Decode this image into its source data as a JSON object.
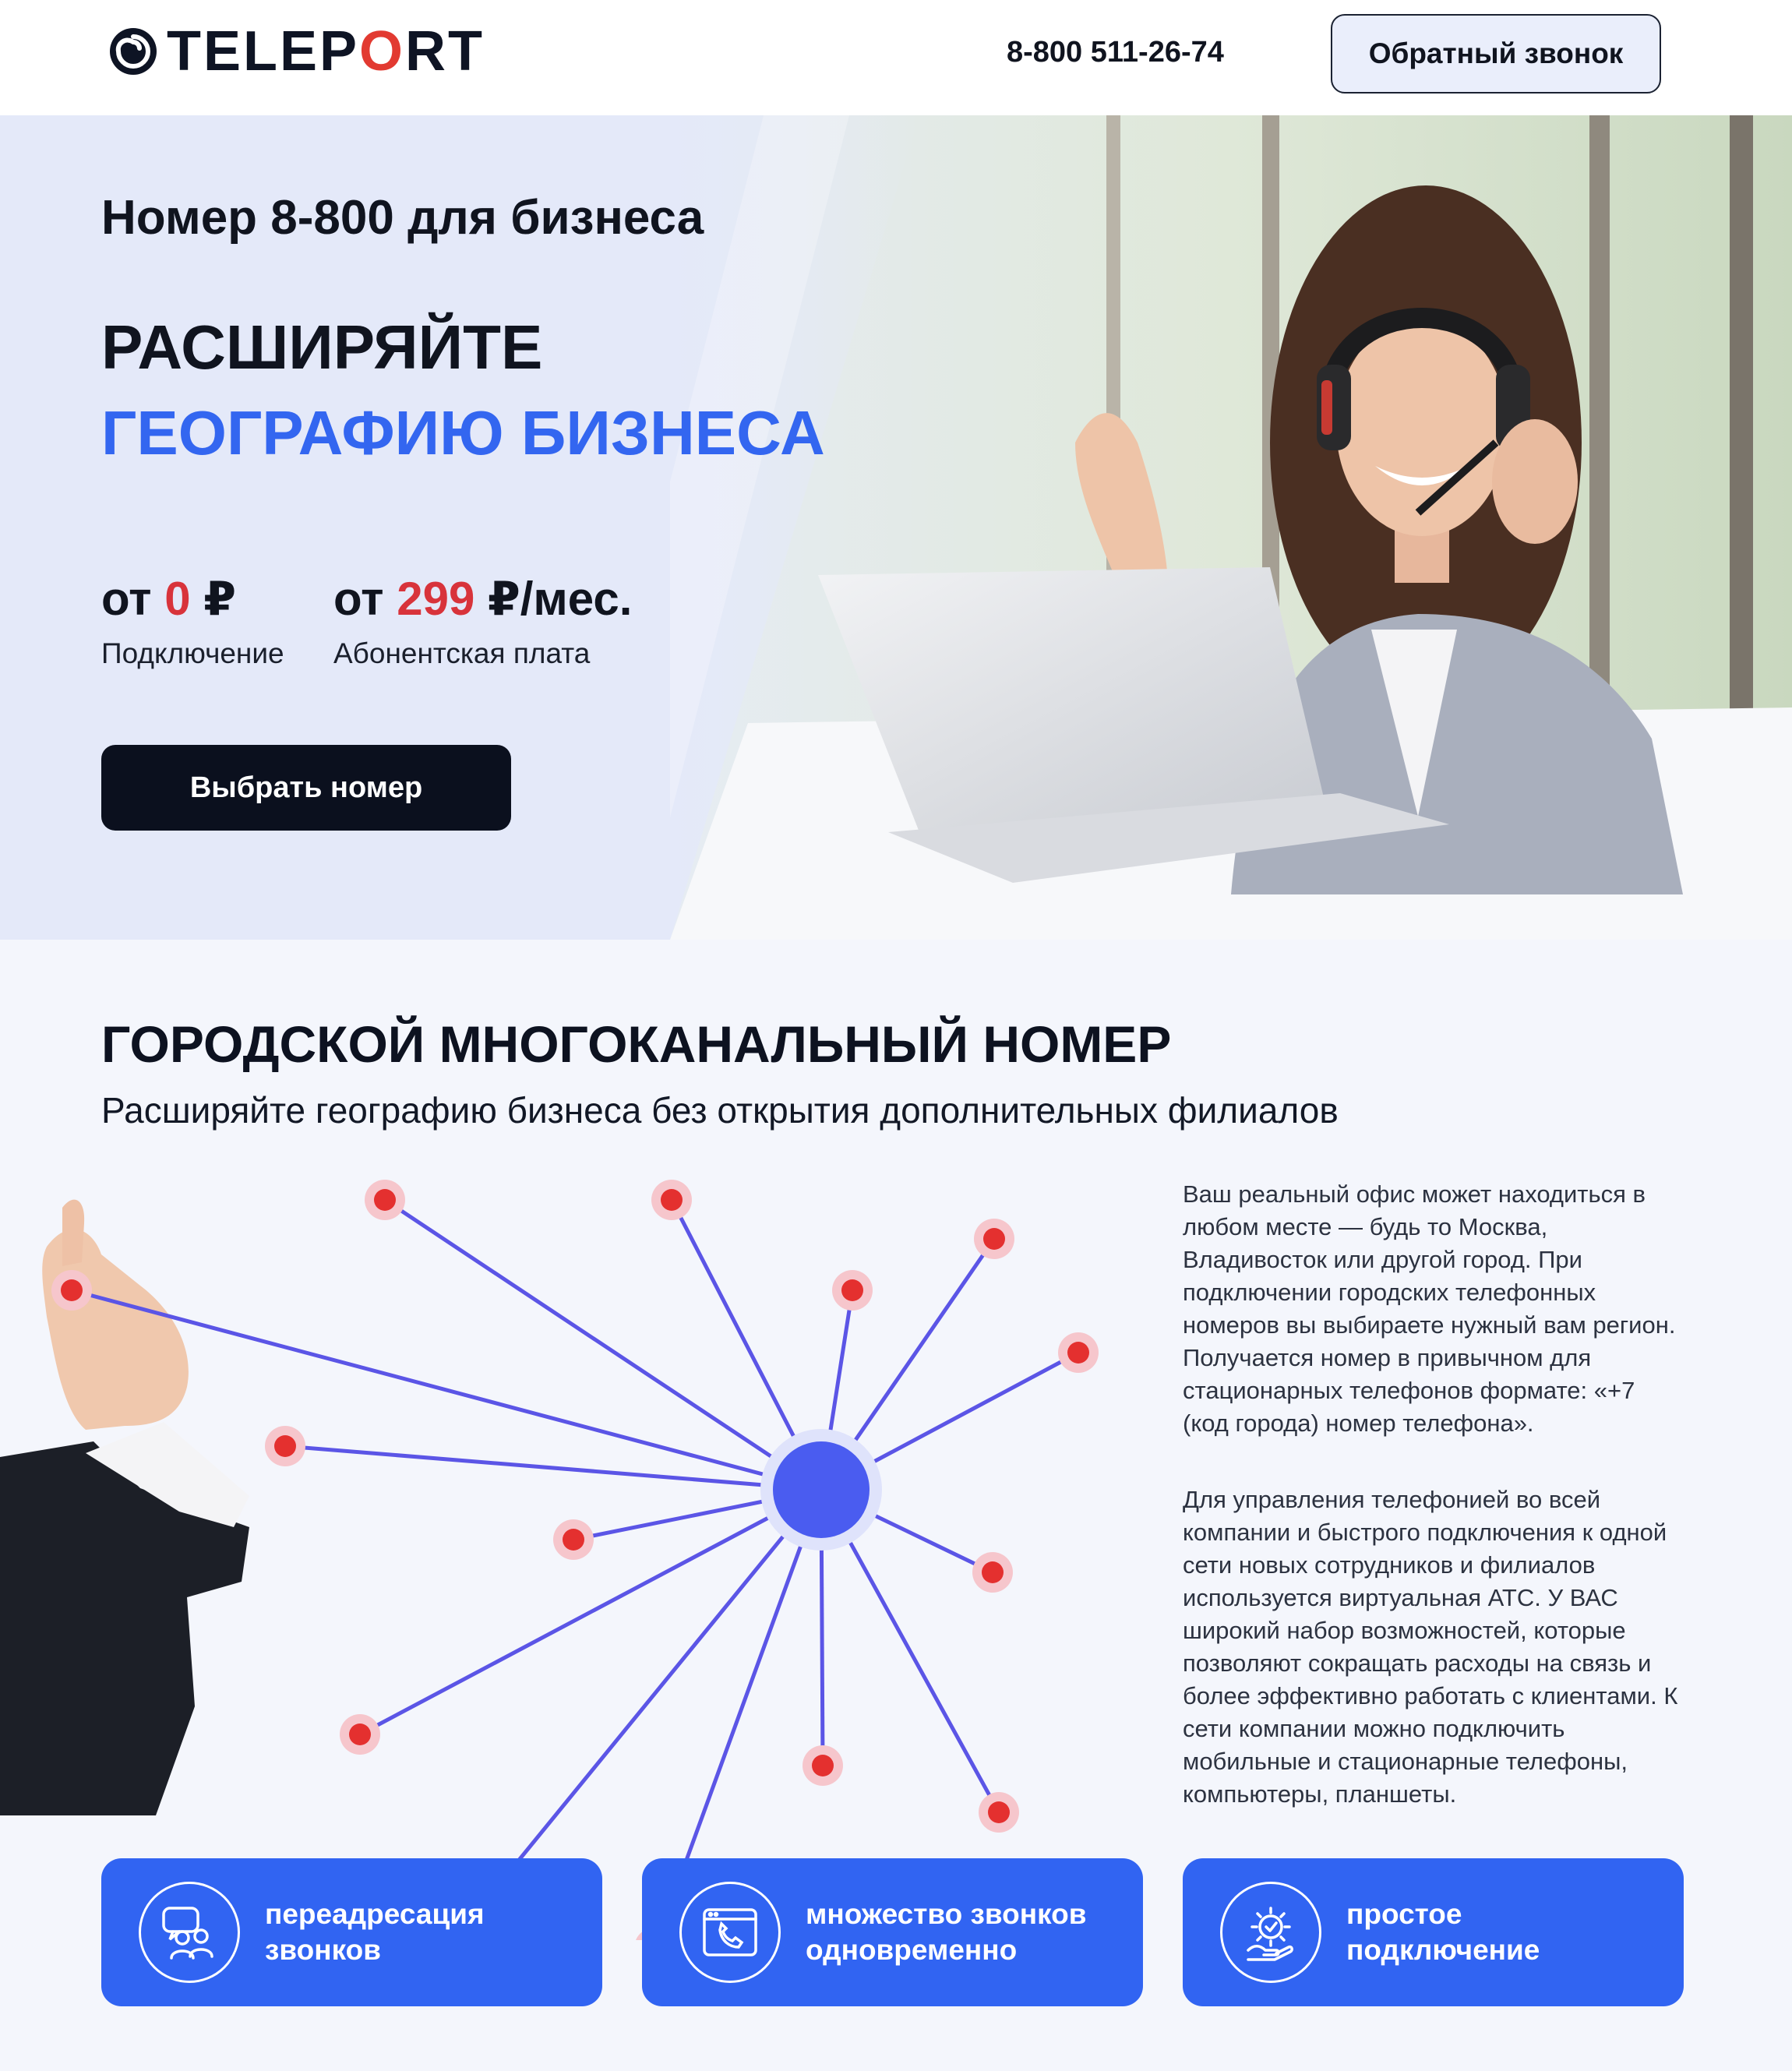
{
  "header": {
    "brand_pre": "TELEP",
    "brand_o": "O",
    "brand_post": "RT",
    "phone": "8-800 511-26-74",
    "callback_label": "Обратный звонок"
  },
  "hero": {
    "kicker": "Номер 8-800 для бизнеса",
    "title_line1": "РАСШИРЯЙТЕ",
    "title_line2": "ГЕОГРАФИЮ БИЗНЕСА",
    "price_connect": {
      "prefix": "от ",
      "amount": "0",
      "suffix": " ₽",
      "label": "Подключение"
    },
    "price_monthly": {
      "prefix": "от ",
      "amount": "299",
      "suffix": " ₽/мес.",
      "label": "Абонентская плата"
    },
    "cta_label": "Выбрать номер"
  },
  "section": {
    "title": "ГОРОДСКОЙ МНОГОКАНАЛЬНЫЙ НОМЕР",
    "subtitle": "Расширяйте географию бизнеса без открытия дополнительных филиалов",
    "paragraph1": "Ваш реальный офис может находиться в любом месте — будь то Москва, Владивосток или другой город. При подключении городских телефонных номеров вы выбираете нужный вам регион. Получается номер в привычном для стационарных телефонов формате: «+7 (код города) номер телефона».",
    "paragraph2": "Для управления телефонией во всей компании и быстрого подключения к одной сети новых сотрудников и филиалов используется виртуальная АТС. У ВАС широкий набор возможностей, которые позволяют сокращать расходы на связь и более эффективно работать с клиентами. К сети компании можно подключить мобильные и стационарные телефоны, компьютеры, планшеты."
  },
  "features": [
    {
      "label": "переадресация звонков",
      "icon": "people-chat-icon"
    },
    {
      "label": "множество звонков одновременно",
      "icon": "browser-phone-icon"
    },
    {
      "label": "простое подключение",
      "icon": "gear-check-icon"
    }
  ],
  "colors": {
    "accent_blue": "#3164f2",
    "title_blue": "#3366f0",
    "price_red": "#d8333b",
    "hero_bg": "#e4e9f9",
    "dark_button": "#0b101e"
  }
}
